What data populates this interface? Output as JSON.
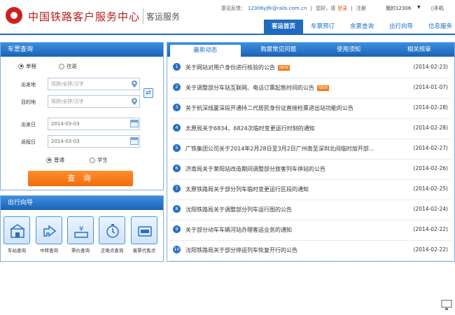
{
  "header": {
    "title": "中国铁路客户服务中心",
    "subtitle": "客运服务",
    "feedback_label": "意见反馈：",
    "feedback_email": "12306yjfk@rails.com.cn",
    "greeting": "您好，请",
    "login": "登录",
    "separator": "|",
    "register": "注册",
    "my12306": "我的12306",
    "caret": "▼",
    "mobile": "手机"
  },
  "nav": [
    {
      "label": "客运首页",
      "active": true
    },
    {
      "label": "车票预订",
      "active": false
    },
    {
      "label": "余票查询",
      "active": false
    },
    {
      "label": "出行向导",
      "active": false
    },
    {
      "label": "信息服务",
      "active": false
    }
  ],
  "ticket": {
    "title": "车票查询",
    "one_way": "单程",
    "round_trip": "往返",
    "from_label": "出发地",
    "from_placeholder": "简拼/全拼/汉字",
    "to_label": "目的地",
    "to_placeholder": "简拼/全拼/汉字",
    "depart_label": "出发日",
    "depart_value": "2014-03-03",
    "return_label": "返程日",
    "return_value": "2014-03-03",
    "normal": "普通",
    "student": "学生",
    "query_button": "查 询"
  },
  "guide": {
    "title": "出行向导",
    "items": [
      {
        "label": "车站查询",
        "icon": "station-icon"
      },
      {
        "label": "中转查询",
        "icon": "transfer-icon"
      },
      {
        "label": "票价查询",
        "icon": "price-icon"
      },
      {
        "label": "正晚点查询",
        "icon": "clock-icon"
      },
      {
        "label": "客票代售点",
        "icon": "ticket-agency-icon"
      }
    ]
  },
  "news_tabs": [
    {
      "label": "最新动态",
      "active": true
    },
    {
      "label": "购票常见问题",
      "active": false
    },
    {
      "label": "使用须知",
      "active": false
    },
    {
      "label": "相关规章",
      "active": false
    }
  ],
  "news": [
    {
      "num": "1",
      "title": "关于网站对用户身份进行核验的公告",
      "badge": "NEW",
      "date": "(2014-02-23)"
    },
    {
      "num": "2",
      "title": "关于调整部分车站互联网、电话订票起售时间的公告",
      "badge": "NEW",
      "date": "(2014-01-07)"
    },
    {
      "num": "3",
      "title": "关于杭深线厦深段开通持二代居民身份证直接检票进出站功能的公告",
      "badge": "",
      "date": "(2014-02-28)"
    },
    {
      "num": "4",
      "title": "太原局关于6834、6824次临时变更运行时刻的通知",
      "badge": "",
      "date": "(2014-02-28)"
    },
    {
      "num": "5",
      "title": "广铁集团公司关于2014年2月28日至3月2日广州南至深圳北间临时加开部...",
      "badge": "",
      "date": "(2014-02-27)"
    },
    {
      "num": "6",
      "title": "济南局关于莱阳站改造期间调整部分旅客列车停站的公告",
      "badge": "",
      "date": "(2014-02-26)"
    },
    {
      "num": "7",
      "title": "太原铁路局关于部分列车临时变更运行区段的通知",
      "badge": "",
      "date": "(2014-02-25)"
    },
    {
      "num": "8",
      "title": "沈阳铁路局关于调整部分列车运行图的公告",
      "badge": "",
      "date": "(2014-02-24)"
    },
    {
      "num": "9",
      "title": "关于部分动车车辆河站办理客运业务的通知",
      "badge": "",
      "date": "(2014-02-22)"
    },
    {
      "num": "10",
      "title": "沈阳铁路局关于部分停运列车恢复开行的公告",
      "badge": "",
      "date": "(2014-02-22)"
    }
  ],
  "colors": {
    "brand_red": "#d01f1f",
    "nav_blue": "#1e6cc0",
    "accent_orange": "#f36c0b"
  }
}
